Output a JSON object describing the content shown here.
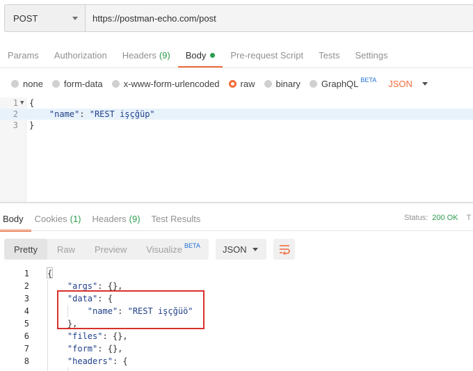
{
  "request": {
    "method": "POST",
    "url": "https://postman-echo.com/post",
    "tabs": [
      {
        "label": "Params",
        "count": ""
      },
      {
        "label": "Authorization",
        "count": ""
      },
      {
        "label": "Headers",
        "count": "(9)"
      },
      {
        "label": "Body",
        "count": ""
      },
      {
        "label": "Pre-request Script",
        "count": ""
      },
      {
        "label": "Tests",
        "count": ""
      },
      {
        "label": "Settings",
        "count": ""
      }
    ],
    "active_tab": "Body",
    "body_types": [
      "none",
      "form-data",
      "x-www-form-urlencoded",
      "raw",
      "binary",
      "GraphQL"
    ],
    "selected_body_type": "raw",
    "beta_label": "BETA",
    "format": "JSON",
    "editor": {
      "line_numbers": [
        "1",
        "2",
        "3"
      ],
      "line1": "{",
      "line2_key": "\"name\"",
      "line2_sep": ": ",
      "line2_value": "\"REST işçğüp\"",
      "line3": "}"
    }
  },
  "response": {
    "tabs": [
      {
        "label": "Body",
        "count": ""
      },
      {
        "label": "Cookies",
        "count": "(1)"
      },
      {
        "label": "Headers",
        "count": "(9)"
      },
      {
        "label": "Test Results",
        "count": ""
      }
    ],
    "status_label": "Status:",
    "status_value": "200 OK",
    "status_trailing": "T",
    "views": [
      "Pretty",
      "Raw",
      "Preview",
      "Visualize"
    ],
    "visualize_beta": "BETA",
    "format": "JSON",
    "line_numbers": [
      "1",
      "2",
      "3",
      "4",
      "5",
      "6",
      "7",
      "8"
    ],
    "lines": {
      "l1": "{",
      "l2_key": "\"args\"",
      "l2_rest": ": {},",
      "l3_key": "\"data\"",
      "l3_rest": ": {",
      "l4_key": "\"name\"",
      "l4_sep": ": ",
      "l4_value": "\"REST işçğüö\"",
      "l5": "},",
      "l6_key": "\"files\"",
      "l6_rest": ": {},",
      "l7_key": "\"form\"",
      "l7_rest": ": {},",
      "l8_key": "\"headers\"",
      "l8_rest": ": {"
    }
  },
  "colors": {
    "accent": "#f26b3a",
    "success": "#2a9c4c",
    "beta": "#1f6fd6",
    "annotation": "#d9302c"
  }
}
